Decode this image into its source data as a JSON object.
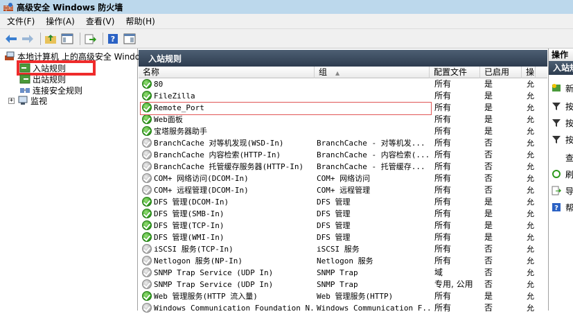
{
  "window": {
    "title": "高级安全 Windows 防火墙"
  },
  "menu": [
    "文件(F)",
    "操作(A)",
    "查看(V)",
    "帮助(H)"
  ],
  "toolbar": {
    "icons": [
      "back-arrow-icon",
      "forward-arrow-icon",
      "up-folder-icon",
      "show-hide-tree-icon",
      "export-list-icon",
      "help-icon",
      "properties-icon"
    ]
  },
  "tree": {
    "root": "本地计算机 上的高级安全 Windows",
    "items": [
      "入站规则",
      "出站规则",
      "连接安全规则",
      "监视"
    ],
    "expand_glyph": "+"
  },
  "center": {
    "title": "入站规则",
    "columns": [
      "名称",
      "组",
      "配置文件",
      "已启用",
      "操"
    ],
    "sort_indicator": "▲",
    "rows": [
      {
        "name": "80",
        "group": "",
        "profile": "所有",
        "enabled": "是",
        "action": "允",
        "on": true
      },
      {
        "name": "FileZilla",
        "group": "",
        "profile": "所有",
        "enabled": "是",
        "action": "允",
        "on": true
      },
      {
        "name": "Remote_Port",
        "group": "",
        "profile": "所有",
        "enabled": "是",
        "action": "允",
        "on": true
      },
      {
        "name": "Web面板",
        "group": "",
        "profile": "所有",
        "enabled": "是",
        "action": "允",
        "on": true
      },
      {
        "name": "宝塔服务器助手",
        "group": "",
        "profile": "所有",
        "enabled": "是",
        "action": "允",
        "on": true
      },
      {
        "name": "BranchCache 对等机发现(WSD-In)",
        "group": "BranchCache - 对等机发...",
        "profile": "所有",
        "enabled": "否",
        "action": "允",
        "on": false
      },
      {
        "name": "BranchCache 内容检索(HTTP-In)",
        "group": "BranchCache - 内容检索(...",
        "profile": "所有",
        "enabled": "否",
        "action": "允",
        "on": false
      },
      {
        "name": "BranchCache 托管缓存服务器(HTTP-In)",
        "group": "BranchCache - 托管缓存...",
        "profile": "所有",
        "enabled": "否",
        "action": "允",
        "on": false
      },
      {
        "name": "COM+ 网络访问(DCOM-In)",
        "group": "COM+ 网络访问",
        "profile": "所有",
        "enabled": "否",
        "action": "允",
        "on": false
      },
      {
        "name": "COM+ 远程管理(DCOM-In)",
        "group": "COM+ 远程管理",
        "profile": "所有",
        "enabled": "否",
        "action": "允",
        "on": false
      },
      {
        "name": "DFS 管理(DCOM-In)",
        "group": "DFS 管理",
        "profile": "所有",
        "enabled": "是",
        "action": "允",
        "on": true
      },
      {
        "name": "DFS 管理(SMB-In)",
        "group": "DFS 管理",
        "profile": "所有",
        "enabled": "是",
        "action": "允",
        "on": true
      },
      {
        "name": "DFS 管理(TCP-In)",
        "group": "DFS 管理",
        "profile": "所有",
        "enabled": "是",
        "action": "允",
        "on": true
      },
      {
        "name": "DFS 管理(WMI-In)",
        "group": "DFS 管理",
        "profile": "所有",
        "enabled": "是",
        "action": "允",
        "on": true
      },
      {
        "name": "iSCSI 服务(TCP-In)",
        "group": "iSCSI 服务",
        "profile": "所有",
        "enabled": "否",
        "action": "允",
        "on": false
      },
      {
        "name": "Netlogon 服务(NP-In)",
        "group": "Netlogon 服务",
        "profile": "所有",
        "enabled": "否",
        "action": "允",
        "on": false
      },
      {
        "name": "SNMP Trap Service (UDP In)",
        "group": "SNMP Trap",
        "profile": "域",
        "enabled": "否",
        "action": "允",
        "on": false
      },
      {
        "name": "SNMP Trap Service (UDP In)",
        "group": "SNMP Trap",
        "profile": "专用, 公用",
        "enabled": "否",
        "action": "允",
        "on": false
      },
      {
        "name": "Web 管理服务(HTTP 流入量)",
        "group": "Web 管理服务(HTTP)",
        "profile": "所有",
        "enabled": "是",
        "action": "允",
        "on": true
      },
      {
        "name": "Windows Communication Foundation N...",
        "group": "Windows Communication F...",
        "profile": "所有",
        "enabled": "否",
        "action": "允",
        "on": false
      }
    ]
  },
  "actions": {
    "header": "操作",
    "section": "入站规则",
    "items": [
      "新",
      "按",
      "按",
      "按",
      "查",
      "刷",
      "导",
      "帮"
    ]
  }
}
